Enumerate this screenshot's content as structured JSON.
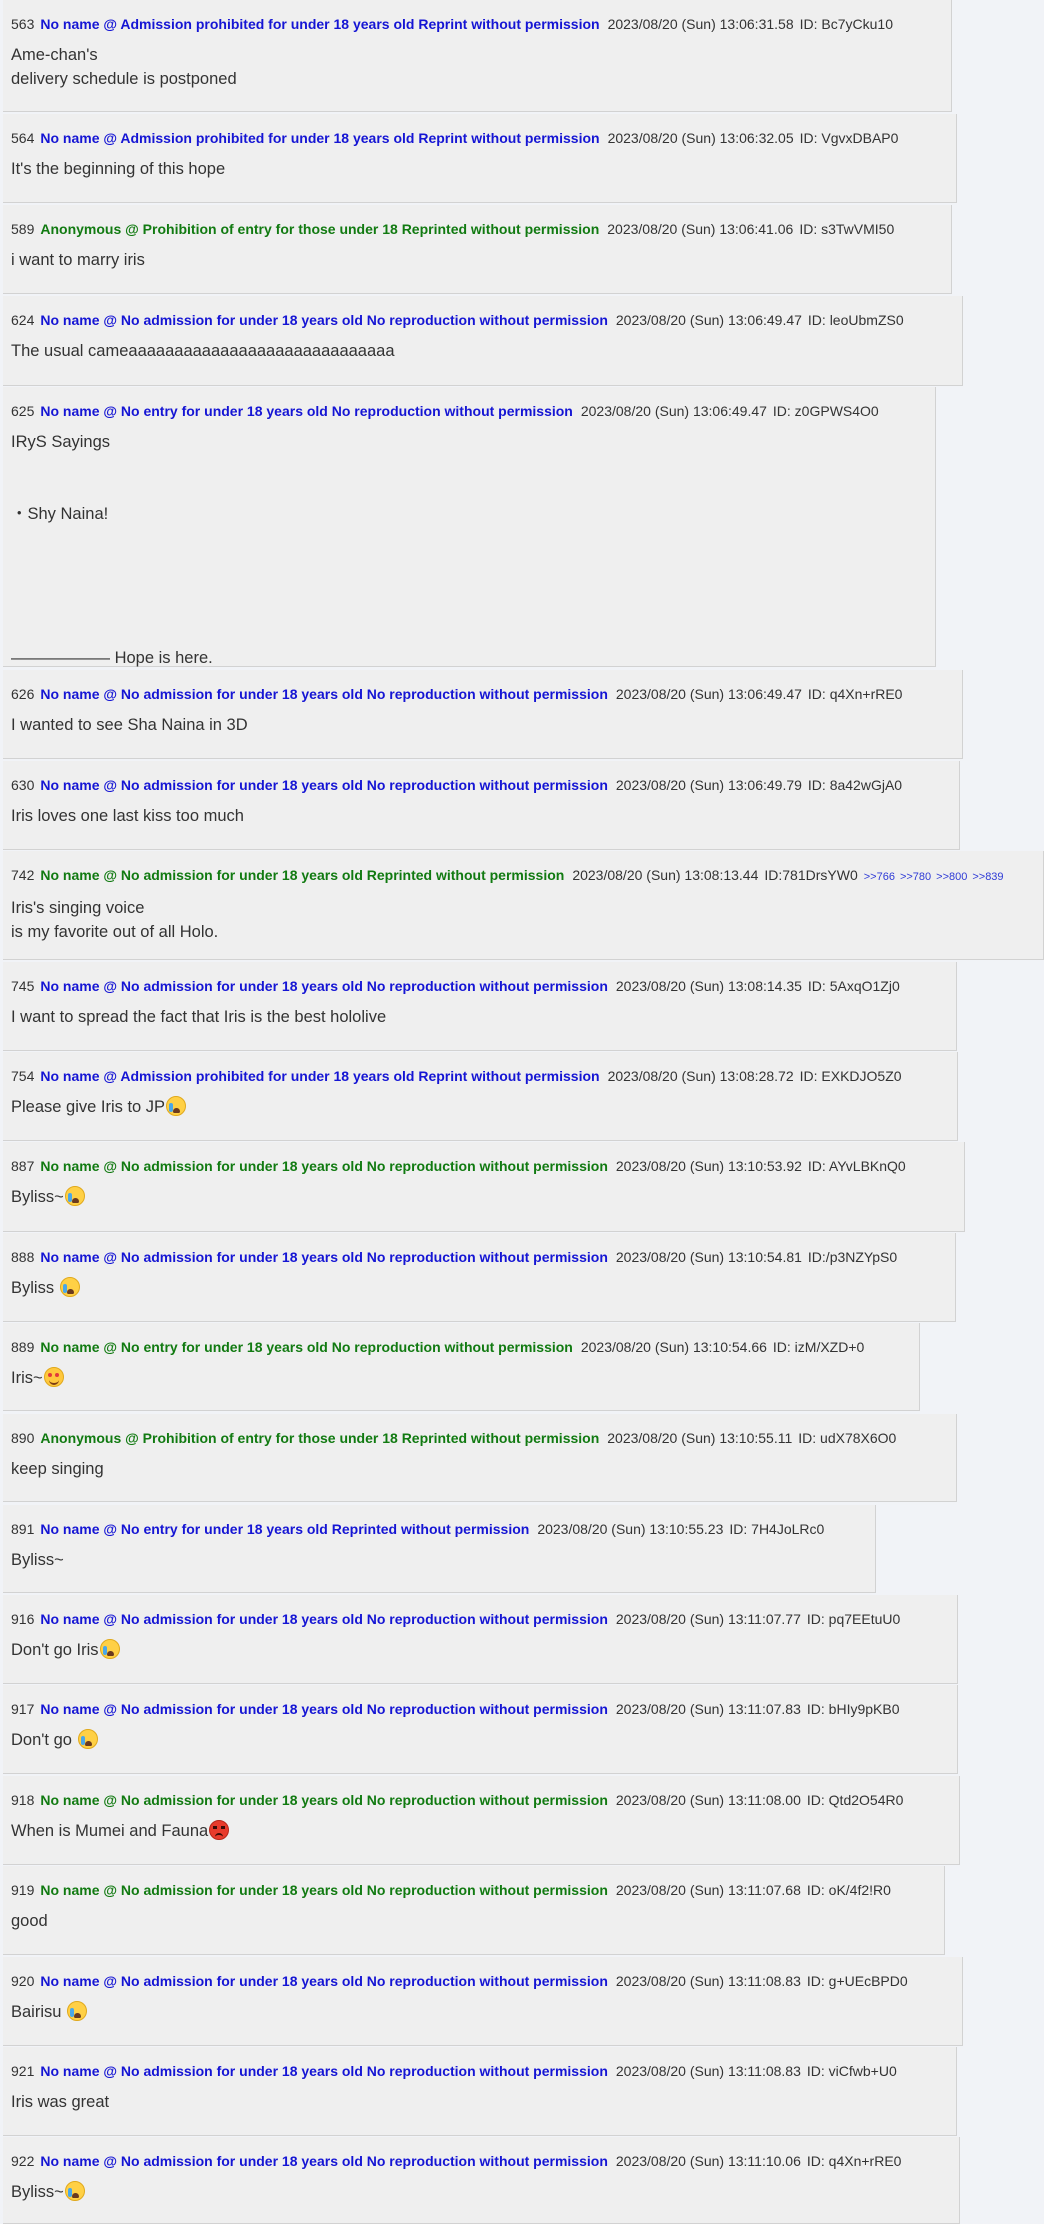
{
  "colors": {
    "page_background": "#f1f3f7",
    "post_background": "#efefef",
    "name_blue": "#1515d4",
    "name_green": "#117a11",
    "text": "#333333",
    "reply_link": "#2f3bd6"
  },
  "posts": [
    {
      "number": "563",
      "name": "No name @ Admission prohibited for under 18 years old Reprint without permission",
      "name_color": "#1515d4",
      "date": "2023/08/20 (Sun) 13:06:31.58",
      "id": "ID: Bc7yCku10",
      "body": "Ame-chan's\ndelivery schedule is postponed",
      "emoji": null,
      "replies": []
    },
    {
      "number": "564",
      "name": "No name @ Admission prohibited for under 18 years old Reprint without permission",
      "name_color": "#1515d4",
      "date": "2023/08/20 (Sun) 13:06:32.05",
      "id": "ID: VgvxDBAP0",
      "body": "It's the beginning of this hope",
      "emoji": null,
      "replies": []
    },
    {
      "number": "589",
      "name": "Anonymous @ Prohibition of entry for those under 18 Reprinted without permission",
      "name_color": "#117a11",
      "date": "2023/08/20 (Sun) 13:06:41.06",
      "id": "ID: s3TwVMI50",
      "body": "i want to marry iris",
      "emoji": null,
      "replies": []
    },
    {
      "number": "624",
      "name": "No name @ No admission for under 18 years old No reproduction without permission",
      "name_color": "#1515d4",
      "date": "2023/08/20 (Sun) 13:06:49.47",
      "id": "ID: leoUbmZS0",
      "body": "The usual cameaaaaaaaaaaaaaaaaaaaaaaaaaaaaa",
      "emoji": null,
      "replies": []
    },
    {
      "number": "625",
      "name": "No name @ No entry for under 18 years old No reproduction without permission",
      "name_color": "#1515d4",
      "date": "2023/08/20 (Sun) 13:06:49.47",
      "id": "ID: z0GPWS4O0",
      "body": "IRyS Sayings\n\n\n・Shy Naina!\n\n\n\n\n\n―――――― Hope is here.",
      "emoji": null,
      "replies": []
    },
    {
      "number": "626",
      "name": "No name @ No admission for under 18 years old No reproduction without permission",
      "name_color": "#1515d4",
      "date": "2023/08/20 (Sun) 13:06:49.47",
      "id": "ID: q4Xn+rRE0",
      "body": "I wanted to see Sha Naina in 3D",
      "emoji": null,
      "replies": []
    },
    {
      "number": "630",
      "name": "No name @ No admission for under 18 years old No reproduction without permission",
      "name_color": "#1515d4",
      "date": "2023/08/20 (Sun) 13:06:49.79",
      "id": "ID: 8a42wGjA0",
      "body": "Iris loves one last kiss too much",
      "emoji": null,
      "replies": []
    },
    {
      "number": "742",
      "name": "No name @ No admission for under 18 years old Reprinted without permission",
      "name_color": "#117a11",
      "date": "2023/08/20 (Sun) 13:08:13.44",
      "id": "ID:781DrsYW0",
      "body": "Iris's singing voice\nis my favorite out of all Holo.",
      "emoji": null,
      "replies": [
        ">>766",
        ">>780",
        ">>800",
        ">>839"
      ]
    },
    {
      "number": "745",
      "name": "No name @ No admission for under 18 years old No reproduction without permission",
      "name_color": "#1515d4",
      "date": "2023/08/20 (Sun) 13:08:14.35",
      "id": "ID: 5AxqO1Zj0",
      "body": "I want to spread the fact that Iris is the best hololive",
      "emoji": null,
      "replies": []
    },
    {
      "number": "754",
      "name": "No name @ Admission prohibited for under 18 years old Reprint without permission",
      "name_color": "#1515d4",
      "date": "2023/08/20 (Sun) 13:08:28.72",
      "id": "ID: EXKDJO5Z0",
      "body": "Please give Iris to JP",
      "emoji": "crying-face",
      "replies": []
    },
    {
      "number": "887",
      "name": "No name @ No admission for under 18 years old No reproduction without permission",
      "name_color": "#117a11",
      "date": "2023/08/20 (Sun) 13:10:53.92",
      "id": "ID: AYvLBKnQ0",
      "body": "Byliss~",
      "emoji": "crying-face",
      "replies": []
    },
    {
      "number": "888",
      "name": "No name @ No admission for under 18 years old No reproduction without permission",
      "name_color": "#1515d4",
      "date": "2023/08/20 (Sun) 13:10:54.81",
      "id": "ID:/p3NZYpS0",
      "body": "Byliss ",
      "emoji": "crying-face",
      "replies": []
    },
    {
      "number": "889",
      "name": "No name @ No entry for under 18 years old No reproduction without permission",
      "name_color": "#117a11",
      "date": "2023/08/20 (Sun) 13:10:54.66",
      "id": "ID: izM/XZD+0",
      "body": "Iris~",
      "emoji": "smiling-face-with-hearts",
      "replies": []
    },
    {
      "number": "890",
      "name": "Anonymous @ Prohibition of entry for those under 18 Reprinted without permission",
      "name_color": "#117a11",
      "date": "2023/08/20 (Sun) 13:10:55.11",
      "id": "ID: udX78X6O0",
      "body": "keep singing",
      "emoji": null,
      "replies": []
    },
    {
      "number": "891",
      "name": "No name @ No entry for under 18 years old Reprinted without permission",
      "name_color": "#1515d4",
      "date": "2023/08/20 (Sun) 13:10:55.23",
      "id": "ID: 7H4JoLRc0",
      "body": "Byliss~",
      "emoji": null,
      "replies": []
    },
    {
      "number": "916",
      "name": "No name @ No admission for under 18 years old No reproduction without permission",
      "name_color": "#1515d4",
      "date": "2023/08/20 (Sun) 13:11:07.77",
      "id": "ID: pq7EEtuU0",
      "body": "Don't go Iris",
      "emoji": "crying-face",
      "replies": []
    },
    {
      "number": "917",
      "name": "No name @ No admission for under 18 years old No reproduction without permission",
      "name_color": "#1515d4",
      "date": "2023/08/20 (Sun) 13:11:07.83",
      "id": "ID: bHIy9pKB0",
      "body": "Don't go ",
      "emoji": "crying-face",
      "replies": []
    },
    {
      "number": "918",
      "name": "No name @ No admission for under 18 years old No reproduction without permission",
      "name_color": "#117a11",
      "date": "2023/08/20 (Sun) 13:11:08.00",
      "id": "ID: Qtd2O54R0",
      "body": "When is Mumei and Fauna",
      "emoji": "angry-face",
      "replies": []
    },
    {
      "number": "919",
      "name": "No name @ No admission for under 18 years old No reproduction without permission",
      "name_color": "#117a11",
      "date": "2023/08/20 (Sun) 13:11:07.68",
      "id": "ID: oK/4f2!R0",
      "body": "good",
      "emoji": null,
      "replies": []
    },
    {
      "number": "920",
      "name": "No name @ No admission for under 18 years old No reproduction without permission",
      "name_color": "#1515d4",
      "date": "2023/08/20 (Sun) 13:11:08.83",
      "id": "ID: g+UEcBPD0",
      "body": "Bairisu ",
      "emoji": "crying-face",
      "replies": []
    },
    {
      "number": "921",
      "name": "No name @ No admission for under 18 years old No reproduction without permission",
      "name_color": "#1515d4",
      "date": "2023/08/20 (Sun) 13:11:08.83",
      "id": "ID: viCfwb+U0",
      "body": "Iris was great",
      "emoji": null,
      "replies": []
    },
    {
      "number": "922",
      "name": "No name @ No admission for under 18 years old No reproduction without permission",
      "name_color": "#1515d4",
      "date": "2023/08/20 (Sun) 13:11:10.06",
      "id": "ID: q4Xn+rRE0",
      "body": "Byliss~",
      "emoji": "crying-face",
      "replies": []
    }
  ]
}
